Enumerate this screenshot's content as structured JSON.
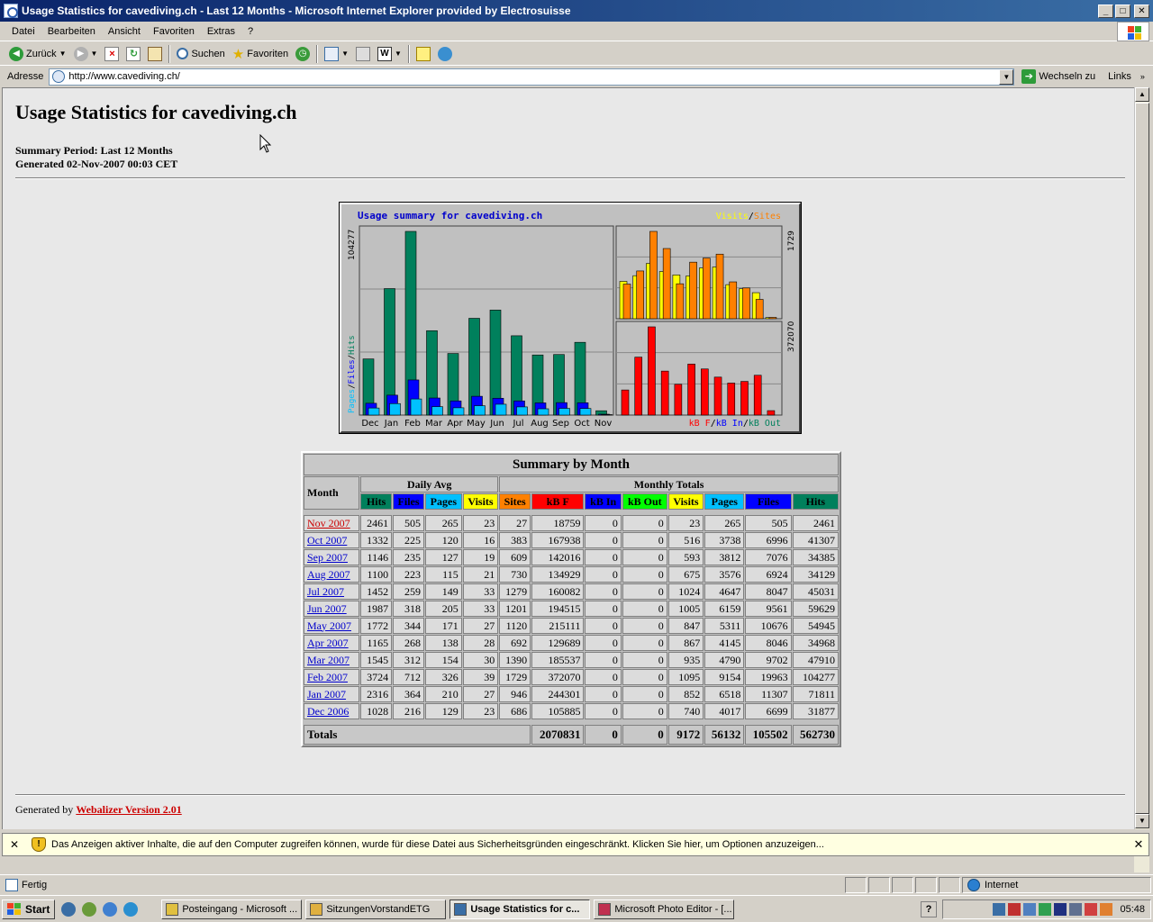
{
  "window": {
    "title": "Usage Statistics for cavediving.ch - Last 12 Months - Microsoft Internet Explorer provided by Electrosuisse"
  },
  "menu": [
    "Datei",
    "Bearbeiten",
    "Ansicht",
    "Favoriten",
    "Extras",
    "?"
  ],
  "toolbar": {
    "back": "Zurück",
    "search": "Suchen",
    "favorites": "Favoriten"
  },
  "address": {
    "label": "Adresse",
    "url": "http://www.cavediving.ch/",
    "go": "Wechseln zu",
    "links": "Links"
  },
  "page": {
    "title": "Usage Statistics for cavediving.ch",
    "summary_period": "Summary Period: Last 12 Months",
    "generated": "Generated 02-Nov-2007 00:03 CET",
    "footer_prefix": "Generated by ",
    "footer_link": "Webalizer Version 2.01"
  },
  "chart_data": {
    "type": "bar",
    "title": "Usage summary for cavediving.ch",
    "categories": [
      "Dec",
      "Jan",
      "Feb",
      "Mar",
      "Apr",
      "May",
      "Jun",
      "Jul",
      "Aug",
      "Sep",
      "Oct",
      "Nov"
    ],
    "main": {
      "max_label": "104277",
      "axis_label": [
        "Pages",
        "Files",
        "Hits"
      ],
      "series": [
        {
          "name": "Hits",
          "values": [
            31877,
            71811,
            104277,
            47910,
            34968,
            54945,
            59629,
            45031,
            34129,
            34385,
            41307,
            2461
          ]
        },
        {
          "name": "Files",
          "values": [
            6699,
            11307,
            19963,
            9702,
            8046,
            10676,
            9561,
            8047,
            6924,
            7076,
            6996,
            505
          ]
        },
        {
          "name": "Pages",
          "values": [
            4017,
            6518,
            9154,
            4790,
            4145,
            5311,
            6159,
            4647,
            3576,
            3812,
            3738,
            265
          ]
        }
      ]
    },
    "sites_chart": {
      "max_label": "1729",
      "legend": [
        "Visits",
        "Sites"
      ],
      "series": [
        {
          "name": "Visits",
          "values": [
            740,
            852,
            1095,
            935,
            867,
            847,
            1005,
            1024,
            675,
            593,
            516,
            23
          ]
        },
        {
          "name": "Sites",
          "values": [
            686,
            946,
            1729,
            1390,
            692,
            1120,
            1201,
            1279,
            730,
            609,
            383,
            27
          ]
        }
      ]
    },
    "kb_chart": {
      "max_label": "372070",
      "legend": [
        "kB F",
        "kB In",
        "kB Out"
      ],
      "series": [
        {
          "name": "kB F",
          "values": [
            105885,
            244301,
            372070,
            185537,
            129689,
            215111,
            194515,
            160082,
            134929,
            142016,
            167938,
            18759
          ]
        }
      ]
    },
    "colors": {
      "hits": "#00805c",
      "files": "#0000ff",
      "pages": "#00c0ff",
      "visits": "#ffff00",
      "sites": "#ff8000",
      "kbf": "#ff0000",
      "kbin": "#0000ff",
      "kbout": "#00805c"
    }
  },
  "table": {
    "caption": "Summary by Month",
    "month_header": "Month",
    "daily_avg_header": "Daily Avg",
    "monthly_totals_header": "Monthly Totals",
    "daily_cols": [
      "Hits",
      "Files",
      "Pages",
      "Visits"
    ],
    "monthly_cols": [
      "Sites",
      "kB F",
      "kB In",
      "kB Out",
      "Visits",
      "Pages",
      "Files",
      "Hits"
    ],
    "col_colors": {
      "Hits": "#00805c",
      "Files": "#0000ff",
      "Pages": "#00c0ff",
      "Visits": "#ffff00",
      "Sites": "#ff8000",
      "kB F": "#ff0000",
      "kB In": "#0000ff",
      "kB Out": "#00ff00"
    },
    "rows": [
      {
        "month": "Nov 2007",
        "d": [
          "2461",
          "505",
          "265",
          "23"
        ],
        "m": [
          "27",
          "18759",
          "0",
          "0",
          "23",
          "265",
          "505",
          "2461"
        ]
      },
      {
        "month": "Oct 2007",
        "d": [
          "1332",
          "225",
          "120",
          "16"
        ],
        "m": [
          "383",
          "167938",
          "0",
          "0",
          "516",
          "3738",
          "6996",
          "41307"
        ]
      },
      {
        "month": "Sep 2007",
        "d": [
          "1146",
          "235",
          "127",
          "19"
        ],
        "m": [
          "609",
          "142016",
          "0",
          "0",
          "593",
          "3812",
          "7076",
          "34385"
        ]
      },
      {
        "month": "Aug 2007",
        "d": [
          "1100",
          "223",
          "115",
          "21"
        ],
        "m": [
          "730",
          "134929",
          "0",
          "0",
          "675",
          "3576",
          "6924",
          "34129"
        ]
      },
      {
        "month": "Jul 2007",
        "d": [
          "1452",
          "259",
          "149",
          "33"
        ],
        "m": [
          "1279",
          "160082",
          "0",
          "0",
          "1024",
          "4647",
          "8047",
          "45031"
        ]
      },
      {
        "month": "Jun 2007",
        "d": [
          "1987",
          "318",
          "205",
          "33"
        ],
        "m": [
          "1201",
          "194515",
          "0",
          "0",
          "1005",
          "6159",
          "9561",
          "59629"
        ]
      },
      {
        "month": "May 2007",
        "d": [
          "1772",
          "344",
          "171",
          "27"
        ],
        "m": [
          "1120",
          "215111",
          "0",
          "0",
          "847",
          "5311",
          "10676",
          "54945"
        ]
      },
      {
        "month": "Apr 2007",
        "d": [
          "1165",
          "268",
          "138",
          "28"
        ],
        "m": [
          "692",
          "129689",
          "0",
          "0",
          "867",
          "4145",
          "8046",
          "34968"
        ]
      },
      {
        "month": "Mar 2007",
        "d": [
          "1545",
          "312",
          "154",
          "30"
        ],
        "m": [
          "1390",
          "185537",
          "0",
          "0",
          "935",
          "4790",
          "9702",
          "47910"
        ]
      },
      {
        "month": "Feb 2007",
        "d": [
          "3724",
          "712",
          "326",
          "39"
        ],
        "m": [
          "1729",
          "372070",
          "0",
          "0",
          "1095",
          "9154",
          "19963",
          "104277"
        ]
      },
      {
        "month": "Jan 2007",
        "d": [
          "2316",
          "364",
          "210",
          "27"
        ],
        "m": [
          "946",
          "244301",
          "0",
          "0",
          "852",
          "6518",
          "11307",
          "71811"
        ]
      },
      {
        "month": "Dec 2006",
        "d": [
          "1028",
          "216",
          "129",
          "23"
        ],
        "m": [
          "686",
          "105885",
          "0",
          "0",
          "740",
          "4017",
          "6699",
          "31877"
        ]
      }
    ],
    "totals": {
      "label": "Totals",
      "values": [
        "2070831",
        "0",
        "0",
        "9172",
        "56132",
        "105502",
        "562730"
      ]
    }
  },
  "infobar": {
    "message": "Das Anzeigen aktiver Inhalte, die auf den Computer zugreifen können, wurde für diese Datei aus Sicherheitsgründen eingeschränkt. Klicken Sie hier, um Optionen anzuzeigen..."
  },
  "status": {
    "text": "Fertig",
    "zone": "Internet"
  },
  "taskbar": {
    "start": "Start",
    "tasks": [
      {
        "label": "Posteingang - Microsoft ...",
        "active": false
      },
      {
        "label": "SitzungenVorstandETG",
        "active": false
      },
      {
        "label": "Usage Statistics for c...",
        "active": true
      },
      {
        "label": "Microsoft Photo Editor - [...",
        "active": false
      }
    ],
    "clock": "05:48",
    "help": "?"
  }
}
